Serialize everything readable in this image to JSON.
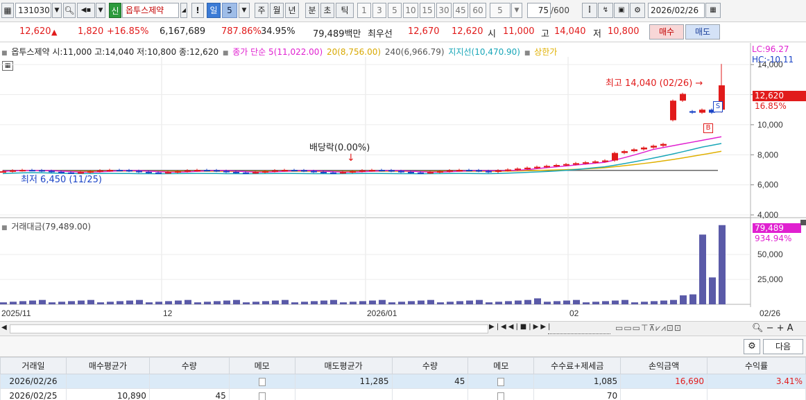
{
  "toolbar": {
    "code": "131030",
    "badge": "신",
    "stock_name": "옵투스제약",
    "excl": "!",
    "period_selected": "일",
    "period_num": "5",
    "periods": [
      "주",
      "월",
      "년",
      "분",
      "초",
      "틱"
    ],
    "minutes": [
      "1",
      "3",
      "5",
      "10",
      "15",
      "30",
      "45",
      "60"
    ],
    "minute_sel": "5",
    "count": "75",
    "count_total": "/600",
    "date": "2026/02/26"
  },
  "quote": {
    "price": "12,620",
    "arrow": "▲",
    "change": "1,820",
    "change_pct": "+16.85%",
    "volume": "6,167,689",
    "vol_ratio": "787.86%",
    "turnover": "34.95%",
    "amount": "79,489백만",
    "best_label": "최우선",
    "best_ask": "12,670",
    "best_bid": "12,620",
    "open_label": "시",
    "open": "11,000",
    "high_label": "고",
    "high": "14,040",
    "low_label": "저",
    "low": "10,800",
    "buy_btn": "매수",
    "sell_btn": "매도"
  },
  "legend": {
    "name": "옵투스제약 시:11,000 고:14,040 저:10,800 종:12,620",
    "ma5": "종가 단순 5(11,022.00)",
    "ma20": "20(8,756.00)",
    "ma240": "240(6,966.79)",
    "support": "지지선(10,470.90)",
    "upper": "상한가",
    "vol": "거래대금(79,489.00)"
  },
  "annotations": {
    "high": "최고 14,040 (02/26)",
    "low": "최저 6,450 (11/25)",
    "dividend": "배당락(0.00%)",
    "lc": "LC:96.27",
    "hc": "HC:-10.11",
    "price_tag": "12,620",
    "pct_tag": "16.85%",
    "vol_tag": "79,489",
    "vol_pct_tag": "934.94%",
    "buy_marker": "B",
    "sell_marker": "S"
  },
  "colors": {
    "up": "#e11b1b",
    "down": "#1a44c7",
    "ma5": "#e020d0",
    "ma20": "#e0b000",
    "ma240": "#666666",
    "support": "#18a6b8",
    "volume": "#5a5aa8"
  },
  "chart_data": {
    "type": "candlestick",
    "price_axis": [
      "14,000",
      "12,000",
      "10,000",
      "8,000",
      "6,000",
      "4,000"
    ],
    "volume_axis": [
      "50,000",
      "25,000"
    ],
    "x_labels": [
      "2025/11",
      "12",
      "2026/01",
      "02",
      "02/26"
    ],
    "price_range": [
      4000,
      14700
    ],
    "volume_range": [
      0,
      80000
    ]
  },
  "nav": {
    "settings_label": "⚙",
    "next_label": "다음"
  },
  "table": {
    "headers": [
      "거래일",
      "매수평균가",
      "수량",
      "메모",
      "매도평균가",
      "수량",
      "메모",
      "수수료+제세금",
      "손익금액",
      "수익률"
    ],
    "rows": [
      {
        "date": "2026/02/26",
        "buy_avg": "",
        "buy_qty": "",
        "sell_avg": "11,285",
        "sell_qty": "45",
        "fee": "1,085",
        "pnl": "16,690",
        "ret": "3.41%"
      },
      {
        "date": "2026/02/25",
        "buy_avg": "10,890",
        "buy_qty": "45",
        "sell_avg": "",
        "sell_qty": "",
        "fee": "70",
        "pnl": "",
        "ret": ""
      }
    ]
  }
}
